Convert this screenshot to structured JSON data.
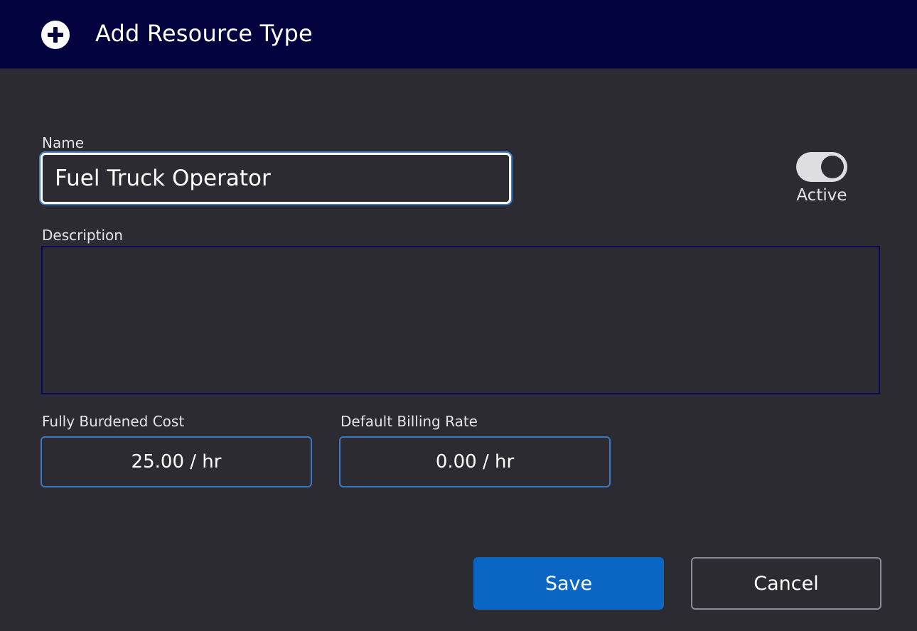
{
  "dialog": {
    "title": "Add Resource Type",
    "header_icon": "plus-circle-icon"
  },
  "form": {
    "name_label": "Name",
    "name_value": "Fuel Truck Operator",
    "active_label": "Active",
    "active_state": true,
    "description_label": "Description",
    "description_value": "",
    "cost_label": "Fully Burdened Cost",
    "cost_value": "25.00 / hr",
    "billing_label": "Default Billing Rate",
    "billing_value": "0.00 / hr"
  },
  "buttons": {
    "save_label": "Save",
    "cancel_label": "Cancel"
  },
  "colors": {
    "header_bg": "#03033f",
    "body_bg": "#2b2b31",
    "primary": "#0a66c2",
    "focus_ring": "#3c7fd1"
  }
}
